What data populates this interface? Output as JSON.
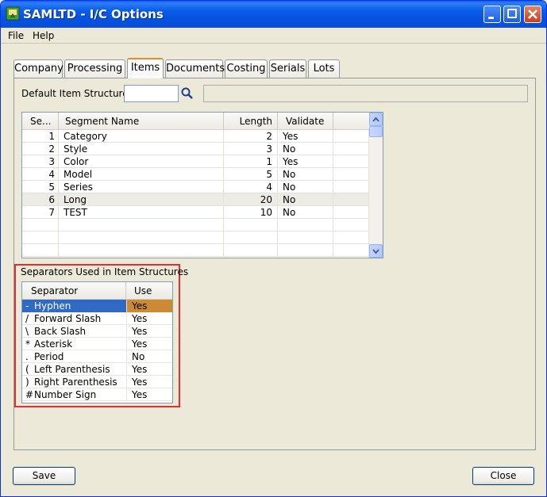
{
  "window": {
    "title": "SAMLTD - I/C Options"
  },
  "menu": {
    "items": [
      {
        "label": "File"
      },
      {
        "label": "Help"
      }
    ]
  },
  "tabs": [
    {
      "label": "Company",
      "active": false
    },
    {
      "label": "Processing",
      "active": false
    },
    {
      "label": "Items",
      "active": true
    },
    {
      "label": "Documents",
      "active": false
    },
    {
      "label": "Costing",
      "active": false
    },
    {
      "label": "Serials",
      "active": false
    },
    {
      "label": "Lots",
      "active": false
    }
  ],
  "default_structure": {
    "label": "Default Item Structure",
    "value": "",
    "description": ""
  },
  "segments": {
    "columns": [
      "Se...",
      "Segment Name",
      "Length",
      "Validate"
    ],
    "rows": [
      {
        "num": "1",
        "name": "Category",
        "length": "2",
        "validate": "Yes"
      },
      {
        "num": "2",
        "name": "Style",
        "length": "3",
        "validate": "No"
      },
      {
        "num": "3",
        "name": "Color",
        "length": "1",
        "validate": "Yes"
      },
      {
        "num": "4",
        "name": "Model",
        "length": "5",
        "validate": "No"
      },
      {
        "num": "5",
        "name": "Series",
        "length": "4",
        "validate": "No"
      },
      {
        "num": "6",
        "name": "Long",
        "length": "20",
        "validate": "No"
      },
      {
        "num": "7",
        "name": "TEST",
        "length": "10",
        "validate": "No"
      }
    ],
    "selected_index": 5
  },
  "separators": {
    "group_label": "Separators Used in Item Structures",
    "columns": [
      "Separator",
      "Use"
    ],
    "rows": [
      {
        "symbol": "-",
        "name": "Hyphen",
        "use": "Yes"
      },
      {
        "symbol": "/",
        "name": "Forward Slash",
        "use": "Yes"
      },
      {
        "symbol": "\\",
        "name": "Back Slash",
        "use": "Yes"
      },
      {
        "symbol": "*",
        "name": "Asterisk",
        "use": "Yes"
      },
      {
        "symbol": ".",
        "name": "Period",
        "use": "No"
      },
      {
        "symbol": "(",
        "name": "Left Parenthesis",
        "use": "Yes"
      },
      {
        "symbol": ")",
        "name": "Right Parenthesis",
        "use": "Yes"
      },
      {
        "symbol": "#",
        "name": "Number Sign",
        "use": "Yes"
      }
    ],
    "selected_index": 0
  },
  "buttons": {
    "save": "Save",
    "close": "Close"
  },
  "colors": {
    "selection_blue": "#316ac5",
    "selection_orange": "#cc8a35",
    "highlight_border": "#e03030"
  }
}
